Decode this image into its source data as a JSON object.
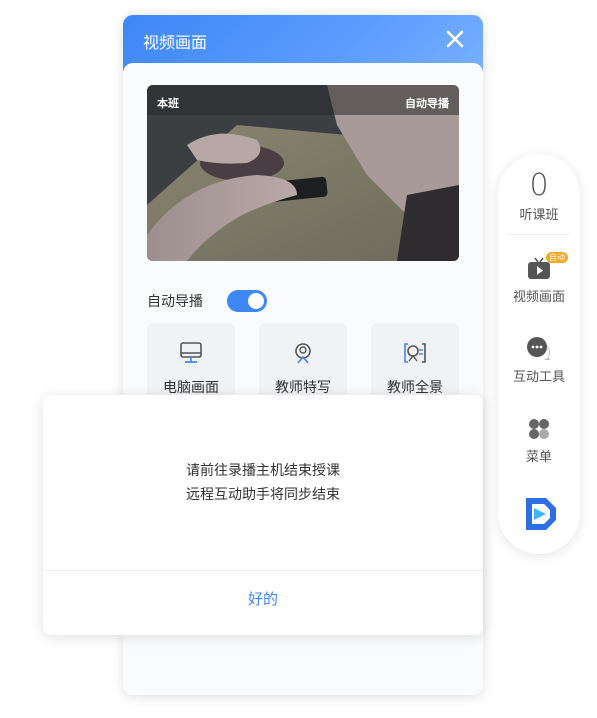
{
  "panel": {
    "title": "视频画面",
    "video": {
      "tag_left": "本班",
      "tag_right": "自动导播"
    },
    "director": {
      "label": "自动导播",
      "enabled": true
    },
    "tiles": [
      {
        "label": "电脑画面",
        "icon": "monitor-icon"
      },
      {
        "label": "教师特写",
        "icon": "teacher-closeup-icon"
      },
      {
        "label": "教师全景",
        "icon": "teacher-panorama-icon"
      }
    ]
  },
  "dialog": {
    "line1": "请前往录播主机结束授课",
    "line2": "远程互动助手将同步结束",
    "ok_label": "好的"
  },
  "sidebar": {
    "listener_count": "0",
    "listener_label": "听课班",
    "items": [
      {
        "label": "视频画面",
        "icon": "tv-icon",
        "badge": "自动"
      },
      {
        "label": "互动工具",
        "icon": "chat-bubble-icon"
      },
      {
        "label": "菜单",
        "icon": "menu-grid-icon"
      }
    ]
  },
  "colors": {
    "accent": "#3f87f5",
    "badge": "#f5a623"
  }
}
